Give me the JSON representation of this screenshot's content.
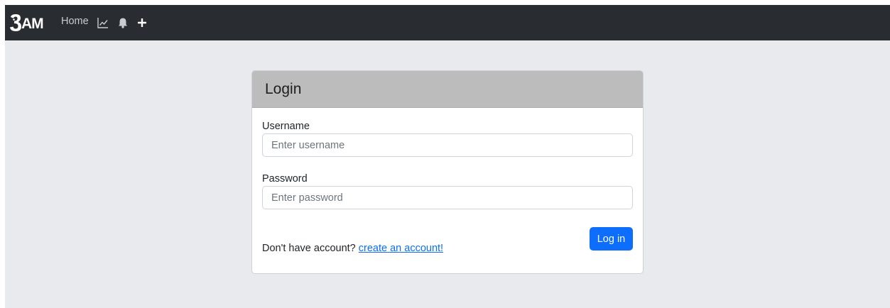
{
  "navbar": {
    "brand": "AM",
    "home": "Home",
    "icons": [
      "chart-line-icon",
      "bell-icon",
      "plus-icon"
    ],
    "background": "#292c30"
  },
  "login": {
    "title": "Login",
    "username_label": "Username",
    "username_placeholder": "Enter username",
    "username_value": "",
    "password_label": "Password",
    "password_placeholder": "Enter password",
    "password_value": "",
    "no_account_text": "Don't have account?",
    "create_account_link": "create an account!",
    "submit_label": "Log in",
    "header_color": "#bcbcbc",
    "primary_color": "#0d6efd"
  }
}
